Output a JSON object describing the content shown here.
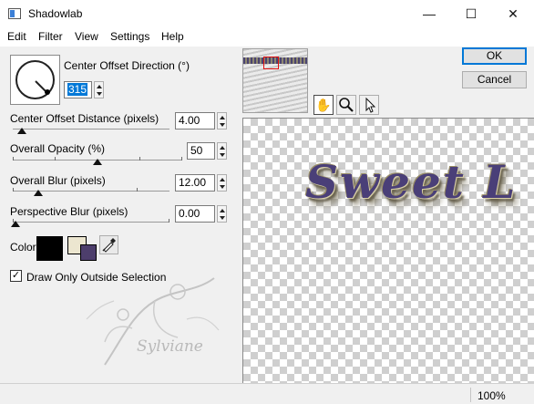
{
  "window": {
    "title": "Shadowlab",
    "minimize": "—",
    "maximize": "☐",
    "close": "✕"
  },
  "menu": [
    "Edit",
    "Filter",
    "View",
    "Settings",
    "Help"
  ],
  "controls": {
    "direction": {
      "label": "Center Offset Direction (°)",
      "value": "315"
    },
    "distance": {
      "label": "Center Offset Distance (pixels)",
      "value": "4.00",
      "level": 0.04
    },
    "opacity": {
      "label": "Overall Opacity (%)",
      "value": "50",
      "level": 0.5
    },
    "blur": {
      "label": "Overall Blur (pixels)",
      "value": "12.00",
      "level": 0.16
    },
    "perspective": {
      "label": "Perspective Blur (pixels)",
      "value": "0.00",
      "level": 0.0
    },
    "color": {
      "label": "Color",
      "shadow": "#000000",
      "background": "#ece6d0",
      "foreground": "#4d3e6c"
    },
    "draw_outside": {
      "label": "Draw Only Outside Selection",
      "checked": true
    }
  },
  "buttons": {
    "ok": "OK",
    "cancel": "Cancel"
  },
  "tools": {
    "pan": "pan-hand-icon",
    "zoom": "zoom-magnifier-icon",
    "select": "arrow-pointer-icon"
  },
  "preview": {
    "text": "Sweet L",
    "text_color": "#4a3f78"
  },
  "watermark": "Sylviane",
  "status": {
    "zoom": "100%"
  }
}
